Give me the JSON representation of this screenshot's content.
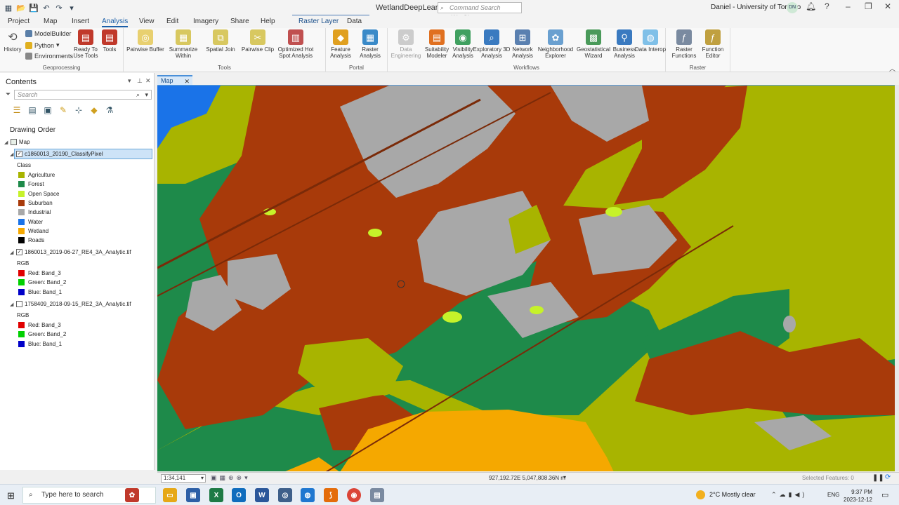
{
  "titlebar": {
    "app_title": "WetlandDeepLearning",
    "command_search": "Command Search (Alt+Q)",
    "user": "Daniel - University of Toronto",
    "avatar": "DN"
  },
  "tabs": [
    "Project",
    "Map",
    "Insert",
    "Analysis",
    "View",
    "Edit",
    "Imagery",
    "Share",
    "Help",
    "Raster Layer",
    "Data"
  ],
  "active_tab": "Analysis",
  "ribbon": {
    "geoprocessing": {
      "label": "Geoprocessing",
      "history": "History",
      "modelbuilder": "ModelBuilder",
      "python": "Python",
      "environments": "Environments",
      "ready_to_use": "Ready To Use Tools",
      "tools": "Tools"
    },
    "tools": {
      "label": "Tools",
      "items": [
        "Pairwise Buffer",
        "Summarize Within",
        "Spatial Join",
        "Pairwise Clip",
        "Optimized Hot Spot Analysis"
      ]
    },
    "portal": {
      "label": "Portal",
      "items": [
        "Feature Analysis",
        "Raster Analysis"
      ]
    },
    "workflows": {
      "label": "Workflows",
      "items": [
        "Data Engineering",
        "Suitability Modeler",
        "Visibility Analysis",
        "Exploratory 3D Analysis",
        "Network Analysis",
        "Neighborhood Explorer",
        "Geostatistical Wizard",
        "Business Analysis",
        "Data Interop"
      ]
    },
    "raster": {
      "label": "Raster",
      "items": [
        "Raster Functions",
        "Function Editor"
      ]
    }
  },
  "contents": {
    "title": "Contents",
    "search_placeholder": "Search",
    "drawing_order": "Drawing Order",
    "map_node": "Map",
    "layer1": {
      "name": "c1860013_20190_ClassifyPixel",
      "group": "Class",
      "classes": [
        {
          "label": "Agriculture",
          "color": "#a8b400"
        },
        {
          "label": "Forest",
          "color": "#1e8a4a"
        },
        {
          "label": "Open Space",
          "color": "#c6f22a"
        },
        {
          "label": "Suburban",
          "color": "#a83a0a"
        },
        {
          "label": "Industrial",
          "color": "#a8a8a8"
        },
        {
          "label": "Water",
          "color": "#1a73e8"
        },
        {
          "label": "Wetland",
          "color": "#f5a800"
        },
        {
          "label": "Roads",
          "color": "#000000"
        }
      ]
    },
    "layer2": {
      "name": "1860013_2019-06-27_RE4_3A_Analytic.tif",
      "group": "RGB",
      "bands": [
        {
          "label": "Red:  Band_3",
          "color": "#e00000"
        },
        {
          "label": "Green:  Band_2",
          "color": "#00d000"
        },
        {
          "label": "Blue:  Band_1",
          "color": "#0000c8"
        }
      ]
    },
    "layer3": {
      "name": "1758409_2018-09-15_RE2_3A_Analytic.tif",
      "group": "RGB",
      "bands": [
        {
          "label": "Red:  Band_3",
          "color": "#e00000"
        },
        {
          "label": "Green:  Band_2",
          "color": "#00d000"
        },
        {
          "label": "Blue:  Band_1",
          "color": "#0000c8"
        }
      ]
    }
  },
  "map": {
    "tab": "Map",
    "scale": "1:34,141",
    "coordinates": "927,192.72E 5,047,808.36N m",
    "selected_features": "Selected Features: 0"
  },
  "taskbar": {
    "search": "Type here to search",
    "weather": "2°C  Mostly clear",
    "lang": "ENG",
    "time": "9:37 PM",
    "date": "2023-12-12"
  }
}
